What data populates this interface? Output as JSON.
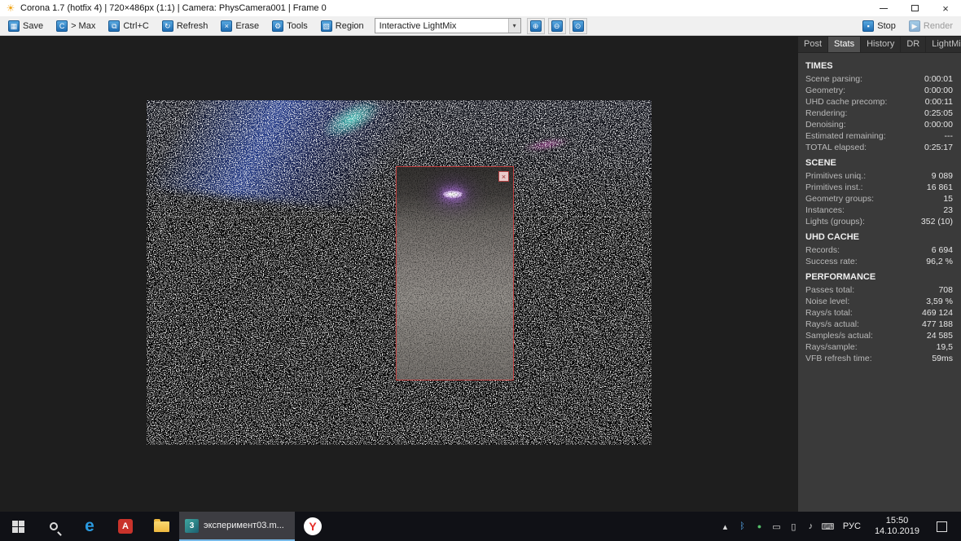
{
  "colors": {
    "accent_blue": "#2b7cd3",
    "region_border_red": "#c24040",
    "taskbar_underline": "#76b9e8",
    "panel_bg": "#3a3a3a"
  },
  "icons": {
    "app": "☀",
    "save": "▦",
    "corona_c": "C",
    "copy": "⧉",
    "refresh": "↻",
    "erase": "×",
    "tools": "⚙",
    "region": "▧",
    "dropdown_arrow": "▾",
    "zoom_in": "⊕",
    "zoom_out": "⊖",
    "zoom_reset": "⊙",
    "stop": "▪",
    "render": "▶",
    "close": "×"
  },
  "titlebar": {
    "title": "Corona 1.7 (hotfix 4) | 720×486px (1:1) | Camera: PhysCamera001 | Frame 0"
  },
  "toolbar": {
    "save": "Save",
    "max": "> Max",
    "copy": "Ctrl+C",
    "refresh": "Refresh",
    "erase": "Erase",
    "tools": "Tools",
    "region": "Region",
    "lightmix_value": "Interactive LightMix",
    "stop": "Stop",
    "render": "Render"
  },
  "panel": {
    "tabs": [
      "Post",
      "Stats",
      "History",
      "DR",
      "LightMix"
    ],
    "active_tab": "Stats",
    "sections": [
      {
        "title": "TIMES",
        "rows": [
          {
            "label": "Scene parsing:",
            "value": "0:00:01"
          },
          {
            "label": "Geometry:",
            "value": "0:00:00"
          },
          {
            "label": "UHD cache precomp:",
            "value": "0:00:11"
          },
          {
            "label": "Rendering:",
            "value": "0:25:05"
          },
          {
            "label": "Denoising:",
            "value": "0:00:00"
          },
          {
            "label": "Estimated remaining:",
            "value": "---"
          },
          {
            "label": "TOTAL elapsed:",
            "value": "0:25:17"
          }
        ]
      },
      {
        "title": "SCENE",
        "rows": [
          {
            "label": "Primitives uniq.:",
            "value": "9 089"
          },
          {
            "label": "Primitives inst.:",
            "value": "16 861"
          },
          {
            "label": "Geometry groups:",
            "value": "15"
          },
          {
            "label": "Instances:",
            "value": "23"
          },
          {
            "label": "Lights (groups):",
            "value": "352 (10)"
          }
        ]
      },
      {
        "title": "UHD CACHE",
        "rows": [
          {
            "label": "Records:",
            "value": "6 694"
          },
          {
            "label": "Success rate:",
            "value": "96,2 %"
          }
        ]
      },
      {
        "title": "PERFORMANCE",
        "rows": [
          {
            "label": "Passes total:",
            "value": "708"
          },
          {
            "label": "Noise level:",
            "value": "3,59 %"
          },
          {
            "label": "Rays/s total:",
            "value": "469 124"
          },
          {
            "label": "Rays/s actual:",
            "value": "477 188"
          },
          {
            "label": "Samples/s actual:",
            "value": "24 585"
          },
          {
            "label": "Rays/sample:",
            "value": "19,5"
          },
          {
            "label": "VFB refresh time:",
            "value": "59ms"
          }
        ]
      }
    ]
  },
  "taskbar": {
    "edge_glyph": "e",
    "red_app_glyph": "A",
    "task_icon_glyph": "3",
    "active_task": "эксперимент03.m...",
    "yandex_glyph": "Y",
    "tray_icons": [
      {
        "name": "hidden-icons-chevron",
        "glyph": "▴"
      },
      {
        "name": "bluetooth-icon",
        "glyph": "ᛒ"
      },
      {
        "name": "battery-saver-icon",
        "glyph": "●"
      },
      {
        "name": "monitor-icon",
        "glyph": "▭"
      },
      {
        "name": "battery-icon",
        "glyph": "▯"
      },
      {
        "name": "volume-icon",
        "glyph": "♪"
      },
      {
        "name": "keyboard-icon",
        "glyph": "⌨"
      }
    ],
    "language": "РУС",
    "time": "15:50",
    "date": "14.10.2019"
  }
}
